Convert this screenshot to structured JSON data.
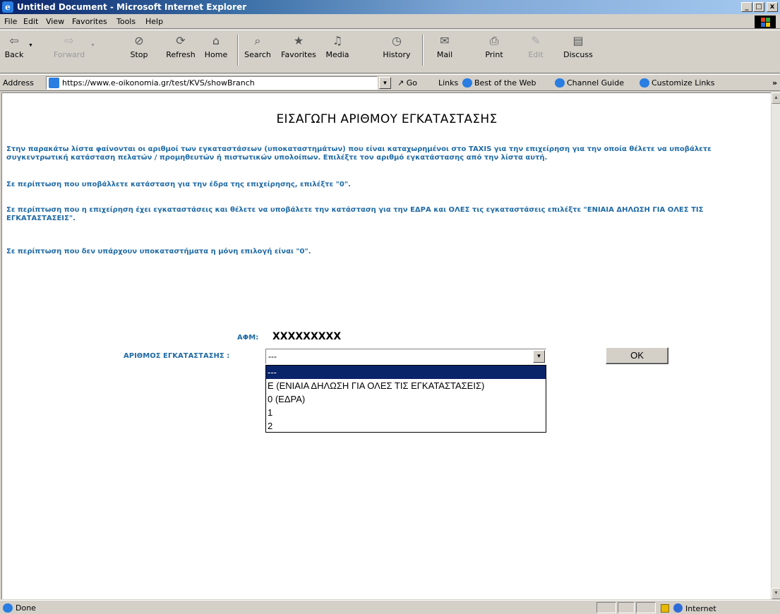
{
  "window": {
    "title": "Untitled Document - Microsoft Internet Explorer",
    "minimize": "_",
    "maximize": "□",
    "close": "x"
  },
  "menu": [
    "File",
    "Edit",
    "View",
    "Favorites",
    "Tools",
    "Help"
  ],
  "toolbar": {
    "back": "Back",
    "forward": "Forward",
    "stop": "Stop",
    "refresh": "Refresh",
    "home": "Home",
    "search": "Search",
    "favorites": "Favorites",
    "media": "Media",
    "history": "History",
    "mail": "Mail",
    "print": "Print",
    "edit": "Edit",
    "discuss": "Discuss"
  },
  "address_bar": {
    "label": "Address",
    "url": "https://www.e-oikonomia.gr/test/KVS/showBranch",
    "go": "Go",
    "links_label": "Links",
    "links": [
      "Best of the Web",
      "Channel Guide",
      "Customize Links"
    ],
    "more": "»"
  },
  "page": {
    "title": "ΕΙΣΑΓΩΓΗ ΑΡΙΘΜΟΥ ΕΓΚΑΤΑΣΤΑΣΗΣ",
    "paragraphs": [
      "Στην παρακάτω λίστα φαίνονται οι αριθμοί των εγκαταστάσεων (υποκαταστημάτων) που είναι καταχωρημένοι στο TAXIS για την επιχείρηση για την οποία θέλετε να υποβάλετε συγκεντρωτική κατάσταση πελατών / προμηθευτών ή πιστωτικών υπολοίπων. Επιλέξτε τον αριθμό εγκατάστασης από την λίστα αυτή.",
      "Σε περίπτωση που υποβάλλετε κατάσταση για την έδρα της επιχείρησης, επιλέξτε \"0\".",
      "Σε περίπτωση που η επιχείρηση έχει εγκαταστάσεις και θέλετε να υποβάλετε την κατάσταση για την ΕΔΡΑ και ΟΛΕΣ τις εγκαταστάσεις επιλέξτε \"ΕΝΙΑΙΑ ΔΗΛΩΣΗ ΓΙΑ ΟΛΕΣ ΤΙΣ ΕΓΚΑΤΑΣΤΑΣΕΙΣ\".",
      "Σε περίπτωση που δεν υπάρχουν υποκαταστήματα η μόνη επιλογή είναι \"0\"."
    ],
    "afm_label": "ΑΦΜ:",
    "afm_value": "XXXXXXXXX",
    "branch_label": "ΑΡΙΘΜΟΣ ΕΓΚΑΤΑΣΤΑΣΗΣ :",
    "branch_selected": "---",
    "branch_options": [
      "---",
      "Ε (ΕΝΙΑΙΑ ΔΗΛΩΣΗ ΓΙΑ ΟΛΕΣ ΤΙΣ ΕΓΚΑΤΑΣΤΑΣΕΙΣ)",
      "0 (ΕΔΡΑ)",
      "1",
      "2"
    ],
    "ok_button": "OK"
  },
  "status_bar": {
    "status": "Done",
    "zone": "Internet"
  },
  "colors": {
    "title_bar": "#0a246a",
    "instruction_text": "#1f6aa5",
    "selection": "#0a246a"
  }
}
